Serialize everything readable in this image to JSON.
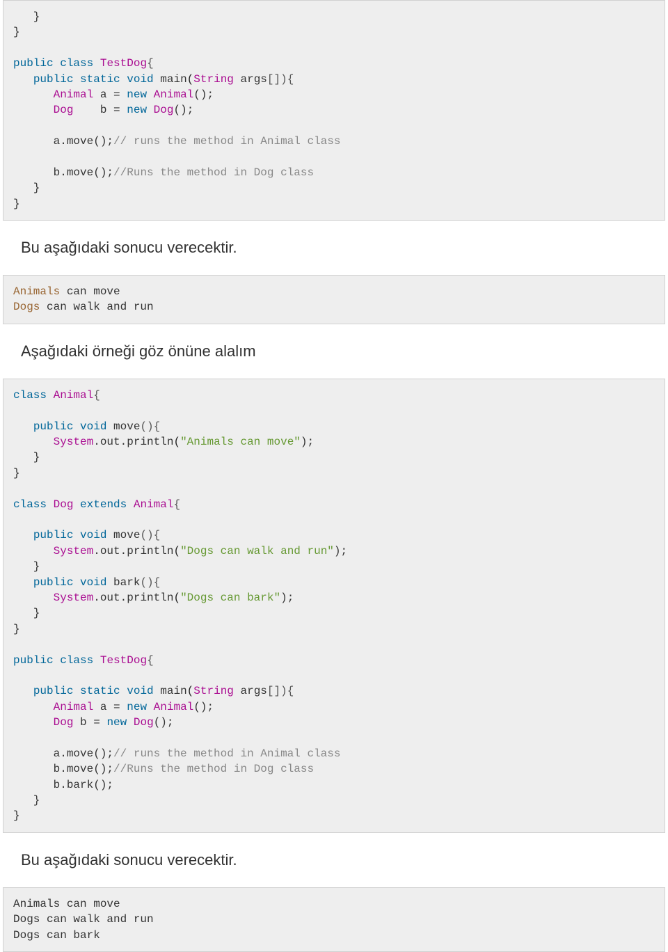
{
  "code1": {
    "l1": "   }",
    "l2": "}",
    "l3": "",
    "pub": "public",
    "cls": "class",
    "TestDog": "TestDog",
    "staticv": "static",
    "void": "void",
    "main": " main",
    "String": "String",
    "args": " args",
    "brk": "[]){",
    "Animal": "Animal",
    "a": " a ",
    "eq": "=",
    "new": "new",
    "Animal2": "Animal",
    "empty": "();",
    "Dog": "Dog",
    "b": "    b ",
    "Dog2": "Dog",
    "avar": "      a",
    "move": ".move();",
    "com1": "// runs the method in Animal class",
    "bvar": "      b",
    "com2": "//Runs the method in Dog class",
    "close1": "   }",
    "close2": "}"
  },
  "prose1": "Bu aşağıdaki sonucu verecektir.",
  "out1": {
    "l1a": "Animals",
    "l1b": " can move",
    "l2a": "Dogs",
    "l2b": " can walk and run"
  },
  "prose2": "Aşağıdaki örneği göz önüne alalım",
  "code2": {
    "cls": "class",
    "Animal": "Animal",
    "brace": "{",
    "pub": "public",
    "void": "void",
    "move": " move",
    "pp": "(){",
    "System": "System",
    "out": ".out.",
    "println": "println",
    "op": "(",
    "s1": "\"Animals can move\"",
    "cp": ");",
    "cb": "   }",
    "cb2": "}",
    "Dog": "Dog",
    "extends": "extends",
    "s2": "\"Dogs can walk and run\"",
    "bark": " bark",
    "s3": "\"Dogs can bark\"",
    "TestDog": "TestDog",
    "staticv": "static",
    "main": " main",
    "String": "String",
    "args": " args",
    "brk": "[]){",
    "Animal2": "Animal",
    "a": " a ",
    "eq": "=",
    "new": "new",
    "empty": "();",
    "Dog2": "Dog",
    "b": " b ",
    "avar": "      a",
    "movec": ".move();",
    "com1": "// runs the method in Animal class",
    "bvar": "      b",
    "com2": "//Runs the method in Dog class",
    "bvar2": "      b",
    "barkc": ".bark();",
    "close1": "   }",
    "close2": "}"
  },
  "prose3": "Bu aşağıdaki sonucu verecektir.",
  "out2": {
    "l1": "Animals can move",
    "l2": "Dogs can walk and run",
    "l3": "Dogs can bark"
  }
}
